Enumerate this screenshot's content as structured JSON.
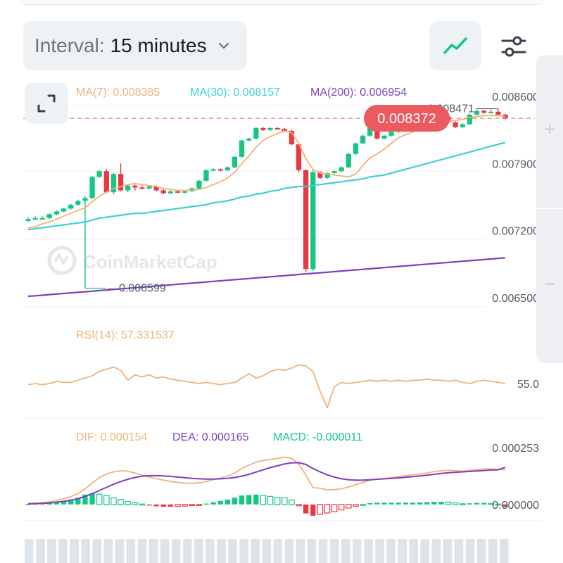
{
  "controls": {
    "interval_label": "Interval:",
    "interval_value": "15 minutes",
    "chart_type_icon": "line-chart-icon",
    "settings_icon": "sliders-icon",
    "expand_icon": "expand-icon"
  },
  "colors": {
    "up": "#16c784",
    "down": "#ea3943",
    "ma7": "#f0b27a",
    "ma30": "#3fd0d4",
    "ma200": "#7e3fbf",
    "price_tag": "#ea5a5f",
    "rsi": "#f0b27a",
    "dif": "#f0b27a",
    "dea": "#7e3fbf",
    "macd_label": "#16c784",
    "axis_text": "#555b66",
    "volume": "#dfe3ea"
  },
  "watermark": "CoinMarketCap",
  "chart_data": [
    {
      "type": "candlestick",
      "legend": {
        "ma7": "MA(7): 0.008385",
        "ma30": "MA(30): 0.008157",
        "ma200": "MA(200): 0.006954"
      },
      "y_ticks": [
        "0.008600",
        "0.007900",
        "0.007200",
        "0.006500"
      ],
      "y_tick_values": [
        0.0086,
        0.0079,
        0.0072,
        0.0065
      ],
      "ylim": [
        0.0065,
        0.0086
      ],
      "current_price": "0.008372",
      "current_price_value": 0.008372,
      "high_marker": "0.008471",
      "high_value": 0.008471,
      "low_marker": "0.006599",
      "low_value": 0.006599,
      "candles": [
        [
          0.0073,
          0.00732,
          0.00734,
          0.00729
        ],
        [
          0.00732,
          0.00733,
          0.00735,
          0.00731
        ],
        [
          0.00733,
          0.00733,
          0.00735,
          0.00732
        ],
        [
          0.00733,
          0.00737,
          0.00738,
          0.00732
        ],
        [
          0.00737,
          0.0074,
          0.00741,
          0.00736
        ],
        [
          0.0074,
          0.00743,
          0.00744,
          0.00739
        ],
        [
          0.00743,
          0.00747,
          0.00748,
          0.00742
        ],
        [
          0.00747,
          0.00751,
          0.00752,
          0.00746
        ],
        [
          0.00751,
          0.00754,
          0.00756,
          0.0066
        ],
        [
          0.00754,
          0.00776,
          0.00777,
          0.00753
        ],
        [
          0.00776,
          0.00782,
          0.00783,
          0.00775
        ],
        [
          0.00782,
          0.0076,
          0.00784,
          0.00759
        ],
        [
          0.0076,
          0.00779,
          0.0078,
          0.00758
        ],
        [
          0.00779,
          0.00762,
          0.0079,
          0.00761
        ],
        [
          0.00762,
          0.00767,
          0.00768,
          0.0076
        ],
        [
          0.00767,
          0.00765,
          0.00768,
          0.00762
        ],
        [
          0.00765,
          0.00764,
          0.00767,
          0.00763
        ],
        [
          0.00764,
          0.00766,
          0.00767,
          0.00763
        ],
        [
          0.00766,
          0.00762,
          0.00767,
          0.00761
        ],
        [
          0.00762,
          0.00759,
          0.00763,
          0.00758
        ],
        [
          0.00759,
          0.00761,
          0.00762,
          0.00758
        ],
        [
          0.00761,
          0.0076,
          0.00762,
          0.00759
        ],
        [
          0.0076,
          0.00761,
          0.00762,
          0.00759
        ],
        [
          0.00761,
          0.00764,
          0.00765,
          0.0076
        ],
        [
          0.00764,
          0.00772,
          0.00773,
          0.00763
        ],
        [
          0.00772,
          0.00783,
          0.00784,
          0.00771
        ],
        [
          0.00783,
          0.00784,
          0.00785,
          0.00782
        ],
        [
          0.00784,
          0.00783,
          0.00785,
          0.00782
        ],
        [
          0.00783,
          0.00786,
          0.00787,
          0.00782
        ],
        [
          0.00786,
          0.00797,
          0.00798,
          0.00785
        ],
        [
          0.00797,
          0.00814,
          0.00815,
          0.00796
        ],
        [
          0.00814,
          0.00816,
          0.00817,
          0.00813
        ],
        [
          0.00816,
          0.00827,
          0.00828,
          0.00815
        ],
        [
          0.00827,
          0.00825,
          0.00828,
          0.00824
        ],
        [
          0.00825,
          0.00827,
          0.00828,
          0.00824
        ],
        [
          0.00827,
          0.00826,
          0.00828,
          0.00825
        ],
        [
          0.00826,
          0.00824,
          0.00827,
          0.00823
        ],
        [
          0.00824,
          0.0081,
          0.00825,
          0.00809
        ],
        [
          0.0081,
          0.00783,
          0.00811,
          0.00781
        ],
        [
          0.00783,
          0.0068,
          0.00784,
          0.00677
        ],
        [
          0.0068,
          0.00781,
          0.00783,
          0.00678
        ],
        [
          0.00781,
          0.00775,
          0.00782,
          0.00774
        ],
        [
          0.00775,
          0.0078,
          0.00781,
          0.00774
        ],
        [
          0.0078,
          0.00782,
          0.00783,
          0.00779
        ],
        [
          0.00782,
          0.00786,
          0.00787,
          0.00781
        ],
        [
          0.00786,
          0.008,
          0.00801,
          0.00785
        ],
        [
          0.008,
          0.00811,
          0.00812,
          0.00799
        ],
        [
          0.00811,
          0.00819,
          0.0082,
          0.0081
        ],
        [
          0.00819,
          0.00829,
          0.0083,
          0.00818
        ],
        [
          0.00829,
          0.00816,
          0.0083,
          0.00815
        ],
        [
          0.00816,
          0.00819,
          0.0082,
          0.00815
        ],
        [
          0.00819,
          0.00823,
          0.00824,
          0.00818
        ],
        [
          0.00823,
          0.00827,
          0.00828,
          0.00822
        ],
        [
          0.00827,
          0.00824,
          0.00828,
          0.00823
        ],
        [
          0.00824,
          0.00829,
          0.0083,
          0.00823
        ],
        [
          0.00829,
          0.00833,
          0.00834,
          0.00828
        ],
        [
          0.00833,
          0.00835,
          0.00836,
          0.00832
        ],
        [
          0.00835,
          0.00841,
          0.00842,
          0.00834
        ],
        [
          0.00841,
          0.00839,
          0.00842,
          0.00838
        ],
        [
          0.00839,
          0.00833,
          0.0084,
          0.00832
        ],
        [
          0.00833,
          0.00828,
          0.00834,
          0.00827
        ],
        [
          0.00828,
          0.00831,
          0.00832,
          0.00827
        ],
        [
          0.00831,
          0.00841,
          0.00842,
          0.0083
        ],
        [
          0.00841,
          0.00845,
          0.00846,
          0.0084
        ],
        [
          0.00845,
          0.00843,
          0.00846,
          0.00842
        ],
        [
          0.00843,
          0.00844,
          0.00846,
          0.00842
        ],
        [
          0.00844,
          0.00841,
          0.00847,
          0.0084
        ],
        [
          0.00841,
          0.00837,
          0.00842,
          0.00836
        ]
      ],
      "ma7": [
        0.00723,
        0.00724,
        0.00727,
        0.00729,
        0.00732,
        0.00735,
        0.00738,
        0.00741,
        0.00744,
        0.0075,
        0.00756,
        0.0076,
        0.00764,
        0.00766,
        0.00768,
        0.00769,
        0.00768,
        0.00767,
        0.00766,
        0.00764,
        0.00763,
        0.00762,
        0.00762,
        0.00762,
        0.00763,
        0.00765,
        0.00768,
        0.00771,
        0.00775,
        0.00781,
        0.0079,
        0.00798,
        0.00807,
        0.00814,
        0.00818,
        0.00821,
        0.00824,
        0.00822,
        0.00811,
        0.00795,
        0.00784,
        0.0078,
        0.00779,
        0.00778,
        0.00777,
        0.00776,
        0.00779,
        0.00788,
        0.00796,
        0.008,
        0.00805,
        0.00811,
        0.00817,
        0.0082,
        0.00823,
        0.00826,
        0.00828,
        0.0083,
        0.00833,
        0.00834,
        0.00835,
        0.00836,
        0.00838,
        0.00839,
        0.0084,
        0.0084,
        0.0084,
        0.00839
      ],
      "ma30": [
        0.00721,
        0.00722,
        0.00723,
        0.00724,
        0.00725,
        0.00726,
        0.00727,
        0.00728,
        0.00729,
        0.00731,
        0.00733,
        0.00734,
        0.00735,
        0.00736,
        0.00737,
        0.00738,
        0.00738,
        0.00739,
        0.0074,
        0.00741,
        0.00742,
        0.00743,
        0.00744,
        0.00745,
        0.00746,
        0.00747,
        0.00749,
        0.0075,
        0.00751,
        0.00753,
        0.00755,
        0.00756,
        0.00758,
        0.00759,
        0.00761,
        0.00762,
        0.00764,
        0.00765,
        0.00766,
        0.00766,
        0.00767,
        0.00768,
        0.00769,
        0.0077,
        0.00771,
        0.00772,
        0.00773,
        0.00774,
        0.00776,
        0.00777,
        0.00778,
        0.0078,
        0.00782,
        0.00784,
        0.00786,
        0.00788,
        0.0079,
        0.00792,
        0.00794,
        0.00796,
        0.00798,
        0.008,
        0.00802,
        0.00804,
        0.00806,
        0.00808,
        0.0081,
        0.00812
      ],
      "ma200": [
        0.006515,
        0.00652,
        0.006526,
        0.006532,
        0.006538,
        0.006544,
        0.00655,
        0.006556,
        0.006562,
        0.006568,
        0.006574,
        0.00658,
        0.006586,
        0.006592,
        0.006598,
        0.006604,
        0.00661,
        0.006616,
        0.006622,
        0.006628,
        0.006634,
        0.00664,
        0.006646,
        0.006652,
        0.006658,
        0.006664,
        0.00667,
        0.006676,
        0.006682,
        0.006688,
        0.006694,
        0.0067,
        0.006706,
        0.006712,
        0.006718,
        0.006724,
        0.00673,
        0.006736,
        0.006742,
        0.006748,
        0.006754,
        0.00676,
        0.006766,
        0.006772,
        0.006778,
        0.006784,
        0.00679,
        0.006796,
        0.006802,
        0.006808,
        0.006814,
        0.00682,
        0.006826,
        0.006832,
        0.006838,
        0.006844,
        0.00685,
        0.006856,
        0.006862,
        0.006868,
        0.006874,
        0.00688,
        0.006886,
        0.006892,
        0.006898,
        0.006904,
        0.00691,
        0.006916
      ]
    },
    {
      "type": "line",
      "legend": "RSI(14): 57.331537",
      "y_ticks": [
        "55.0"
      ],
      "y_tick_values": [
        55.0
      ],
      "ylim": [
        25,
        85
      ],
      "values": [
        54,
        55,
        54,
        55,
        57,
        56,
        56,
        58,
        60,
        62,
        66,
        68,
        70,
        67,
        58,
        63,
        61,
        63,
        60,
        61,
        59,
        58,
        57,
        56,
        55,
        56,
        55,
        54,
        55,
        56,
        60,
        64,
        60,
        62,
        66,
        68,
        67,
        69,
        72,
        71,
        66,
        48,
        33,
        52,
        56,
        55,
        56,
        57,
        58,
        57,
        58,
        57,
        58,
        57,
        58,
        58,
        59,
        58,
        58,
        57,
        58,
        56,
        55,
        57,
        58,
        57,
        56,
        55
      ]
    },
    {
      "type": "bar+line",
      "legend": {
        "dif": "DIF: 0.000154",
        "dea": "DEA: 0.000165",
        "macd": "MACD: -0.000011"
      },
      "y_ticks": [
        "0.000253",
        "0.000000"
      ],
      "y_tick_values": [
        0.000253,
        0.0
      ],
      "ylim": [
        -6e-05,
        0.000253
      ],
      "dif": [
        4e-06,
        6e-06,
        8e-06,
        1.2e-05,
        1.8e-05,
        2.5e-05,
        3.5e-05,
        4.8e-05,
        7e-05,
        9.5e-05,
        0.00012,
        0.000135,
        0.000145,
        0.00015,
        0.000148,
        0.00014,
        0.00013,
        0.000122,
        0.000115,
        0.000108,
        0.000102,
        9.8e-05,
        9.5e-05,
        9.4e-05,
        9.6e-05,
        0.000102,
        0.00011,
        0.000118,
        0.000126,
        0.00014,
        0.00016,
        0.000175,
        0.000188,
        0.000196,
        0.0002,
        0.000205,
        0.00021,
        0.000205,
        0.00018,
        0.00013,
        7.5e-05,
        7.2e-05,
        6.5e-05,
        6.6e-05,
        7e-05,
        7.8e-05,
        8.8e-05,
        9.8e-05,
        0.000108,
        0.000112,
        0.000116,
        0.00012,
        0.000124,
        0.000128,
        0.000132,
        0.000136,
        0.00014,
        0.000146,
        0.00015,
        0.000152,
        0.00015,
        0.000148,
        0.000152,
        0.000156,
        0.000158,
        0.000158,
        0.000156,
        0.000154
      ],
      "dea": [
        3e-06,
        4e-06,
        5e-06,
        7e-06,
        1e-05,
        1.4e-05,
        1.9e-05,
        2.6e-05,
        3.6e-05,
        4.8e-05,
        6.2e-05,
        7.6e-05,
        9e-05,
        0.000102,
        0.000112,
        0.00012,
        0.000126,
        0.000128,
        0.000128,
        0.000127,
        0.000125,
        0.000122,
        0.000119,
        0.000116,
        0.000114,
        0.000113,
        0.000113,
        0.000114,
        0.000116,
        0.00012,
        0.000126,
        0.000134,
        0.000144,
        0.000154,
        0.000164,
        0.000172,
        0.00018,
        0.000185,
        0.000186,
        0.000178,
        0.00016,
        0.000145,
        0.000132,
        0.000122,
        0.000114,
        0.00011,
        0.000108,
        0.000108,
        0.00011,
        0.000112,
        0.000114,
        0.000116,
        0.000118,
        0.000121,
        0.000124,
        0.000127,
        0.00013,
        0.000134,
        0.000138,
        0.000141,
        0.000143,
        0.000145,
        0.000147,
        0.000149,
        0.000151,
        0.000153,
        0.000154,
        0.000165
      ],
      "macd": [
        2e-06,
        4e-06,
        6e-06,
        8e-06,
        1.2e-05,
        1.6e-05,
        2.2e-05,
        3e-05,
        4.4e-05,
        5e-05,
        4.6e-05,
        4e-05,
        3e-05,
        2.2e-05,
        1.4e-05,
        8e-06,
        2e-06,
        -4e-06,
        -8e-06,
        -1e-05,
        -1e-05,
        -9e-06,
        -7e-06,
        -5e-06,
        -2e-06,
        4e-06,
        1e-05,
        1.6e-05,
        2.2e-05,
        3e-05,
        4e-05,
        4.2e-05,
        4.4e-05,
        4e-05,
        3.6e-05,
        3.2e-05,
        3e-05,
        2e-05,
        -6e-06,
        -4e-05,
        -5e-05,
        -4.4e-05,
        -3.8e-05,
        -3.2e-05,
        -2.4e-05,
        -1.6e-05,
        -8e-06,
        0.0,
        6e-06,
        8e-06,
        8e-06,
        8e-06,
        8e-06,
        8e-06,
        8e-06,
        9e-06,
        1e-05,
        1.2e-05,
        1.2e-05,
        1.1e-05,
        7e-06,
        3e-06,
        5e-06,
        7e-06,
        7e-06,
        5e-06,
        2e-06,
        -1.1e-05
      ]
    }
  ]
}
